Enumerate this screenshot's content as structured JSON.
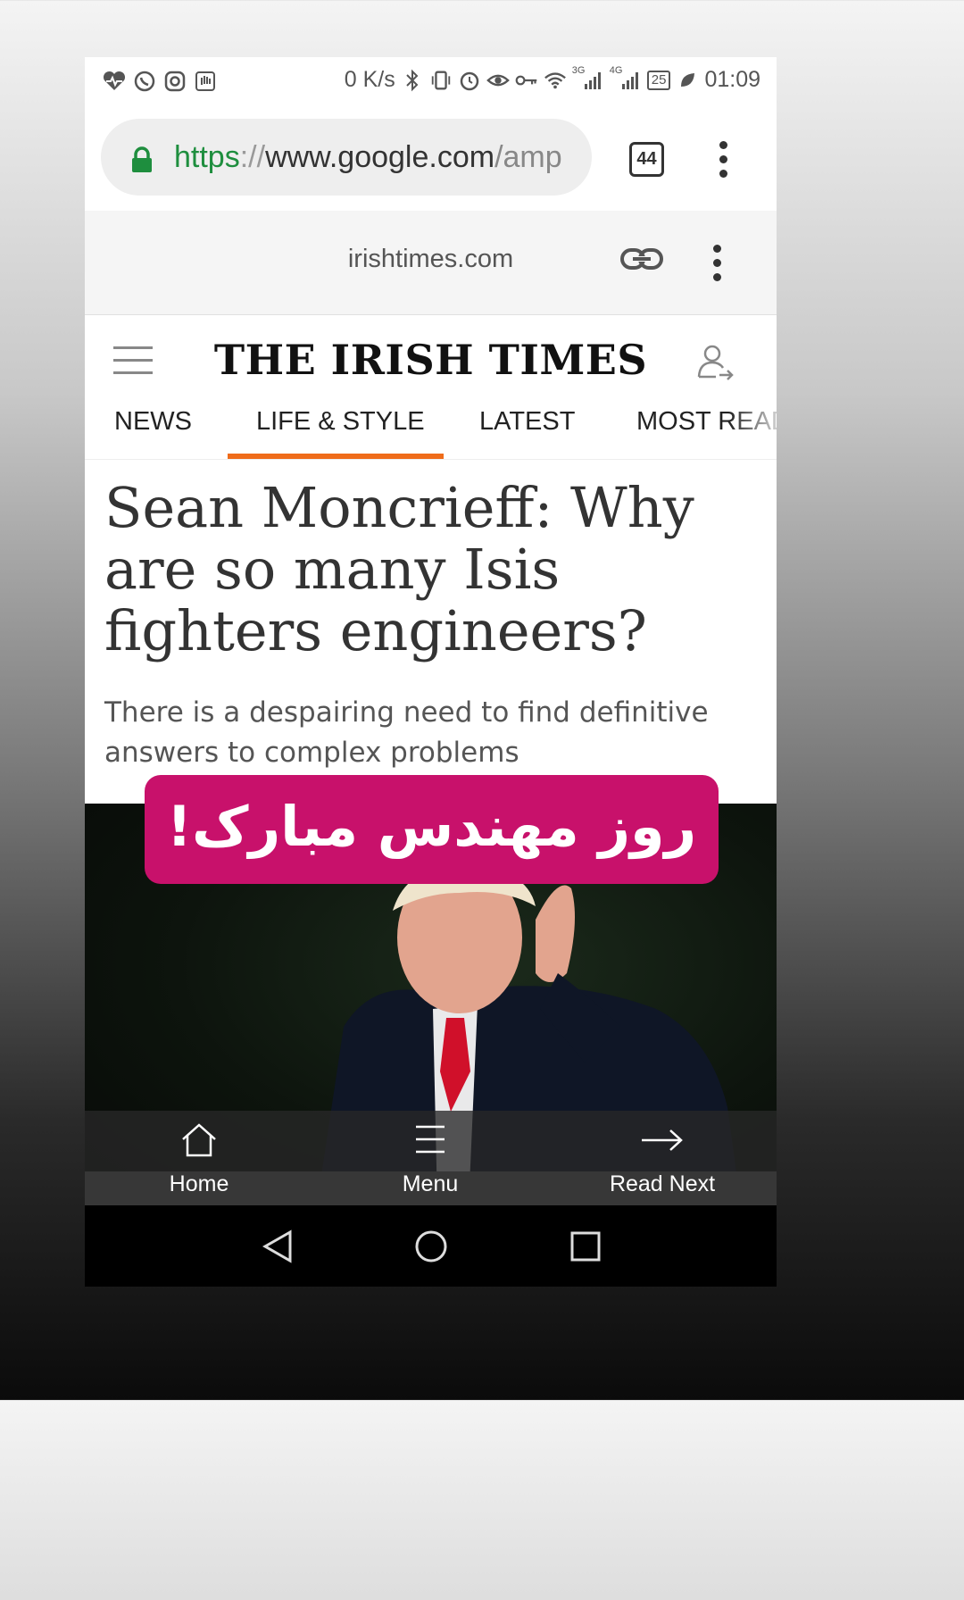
{
  "status_bar": {
    "net_speed": "0 K/s",
    "net_3g": "3G",
    "net_4g": "4G",
    "battery": "25",
    "time": "01:09"
  },
  "browser": {
    "url_scheme": "https",
    "url_sep": "://",
    "url_host": "www.google.com",
    "url_rest": "/amp",
    "tab_count": "44"
  },
  "amp": {
    "domain": "irishtimes.com"
  },
  "site": {
    "masthead": "THE IRISH TIMES",
    "nav": [
      "NEWS",
      "LIFE & STYLE",
      "LATEST",
      "MOST READ"
    ],
    "active_nav": "LIFE & STYLE",
    "accent_color": "#ef6c1a"
  },
  "article": {
    "headline": "Sean Moncrieff: Why are so many Isis fighters engineers?",
    "standfirst": "There is a despairing need to find definitive answers to complex problems"
  },
  "overlay": {
    "banner_text": "روز مهندس مبارک!",
    "banner_color": "#c8116b"
  },
  "bottom_nav": {
    "home": "Home",
    "menu": "Menu",
    "read_next": "Read Next"
  }
}
